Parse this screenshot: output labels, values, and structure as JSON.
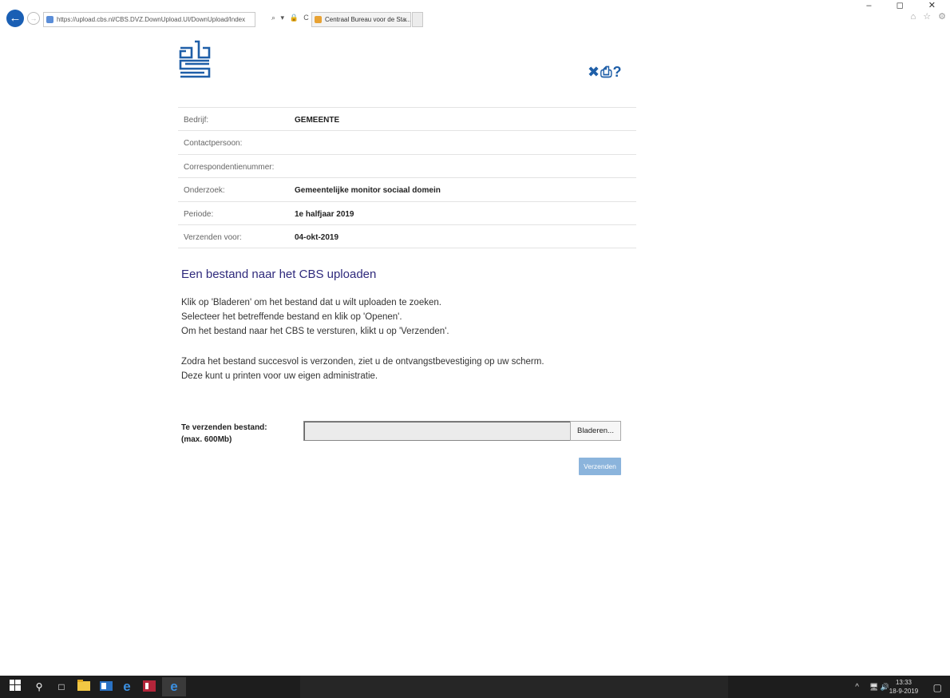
{
  "browser": {
    "url": "https://upload.cbs.nl/CBS.DVZ.DownUpload.UI/DownUpload/Index",
    "tab_title": "Centraal Bureau voor de Sta...",
    "tab_close": "×",
    "address_tools": "⌕ ▾ 🔒 C",
    "window_controls": "–  ◻  ✕",
    "right_icons": "⌂ ☆ ⚙"
  },
  "page": {
    "tools": {
      "close": "✖",
      "print": "⎙",
      "help": "?"
    },
    "info": [
      {
        "label": "Bedrijf:",
        "value": "GEMEENTE"
      },
      {
        "label": "Contactpersoon:",
        "value": ""
      },
      {
        "label": "Correspondentienummer:",
        "value": ""
      },
      {
        "label": "Onderzoek:",
        "value": "Gemeentelijke monitor sociaal domein"
      },
      {
        "label": "Periode:",
        "value": "1e halfjaar 2019"
      },
      {
        "label": "Verzenden voor:",
        "value": "04-okt-2019"
      }
    ],
    "section_title": "Een bestand naar het CBS uploaden",
    "instructions": [
      "Klik op 'Bladeren' om het bestand dat u wilt uploaden te zoeken.",
      "Selecteer het betreffende bestand en klik op 'Openen'.",
      "Om het bestand naar het CBS te versturen, klikt u op 'Verzenden'.",
      "Zodra het bestand succesvol is verzonden, ziet u de ontvangstbevestiging op uw scherm.",
      "Deze kunt u printen voor uw eigen administratie."
    ],
    "upload": {
      "label_line1": "Te verzenden bestand:",
      "label_line2": "(max. 600Mb)",
      "file_value": "",
      "browse_label": "Bladeren...",
      "send_label": "Verzenden"
    }
  },
  "taskbar": {
    "clock_time": "13:33",
    "clock_date": "18-9-2019",
    "tray_chevron": "^",
    "tray_icons": "🖥 🔊"
  },
  "colors": {
    "brand_blue": "#1f5fa8",
    "title_purple": "#2f2a7c",
    "send_button": "#8bb4dc",
    "taskbar": "#1d1d1d"
  }
}
